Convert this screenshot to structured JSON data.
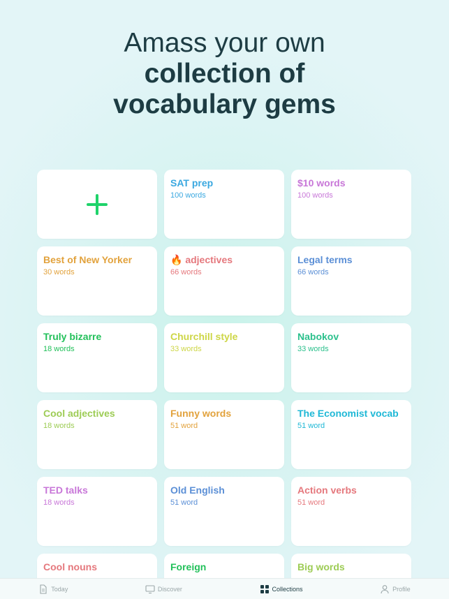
{
  "headline": {
    "line1": "Amass your own",
    "line2": "collection of",
    "line3": "vocabulary gems"
  },
  "collections": [
    {
      "title": "SAT prep",
      "count": "100 words",
      "color": "#3aa8e0"
    },
    {
      "title": "$10 words",
      "count": "100 words",
      "color": "#c877d8"
    },
    {
      "title": "Best of New Yorker",
      "count": "30 words",
      "color": "#e2a23c"
    },
    {
      "title": "🔥 adjectives",
      "count": "66 words",
      "color": "#e5787d"
    },
    {
      "title": "Legal terms",
      "count": "66 words",
      "color": "#5b8fd6"
    },
    {
      "title": "Truly bizarre",
      "count": "18 words",
      "color": "#22c05a"
    },
    {
      "title": "Churchill style",
      "count": "33 words",
      "color": "#cdd646"
    },
    {
      "title": "Nabokov",
      "count": "33 words",
      "color": "#2bc08c"
    },
    {
      "title": "Cool adjectives",
      "count": "18 words",
      "color": "#9dcc55"
    },
    {
      "title": "Funny words",
      "count": "51 word",
      "color": "#e2a23c"
    },
    {
      "title": "The Economist vocab",
      "count": "51 word",
      "color": "#1fb8d6"
    },
    {
      "title": "TED talks",
      "count": "18 words",
      "color": "#c877d8"
    },
    {
      "title": "Old English",
      "count": "51 word",
      "color": "#5b8fd6"
    },
    {
      "title": "Action verbs",
      "count": "51 word",
      "color": "#e5787d"
    },
    {
      "title": "Cool nouns",
      "count": "",
      "color": "#e5787d"
    },
    {
      "title": "Foreign",
      "count": "",
      "color": "#22c05a"
    },
    {
      "title": "Big words",
      "count": "",
      "color": "#9dcc55"
    }
  ],
  "tabs": [
    {
      "label": "Today",
      "icon": "document-icon",
      "active": false
    },
    {
      "label": "Discover",
      "icon": "monitor-icon",
      "active": false
    },
    {
      "label": "Collections",
      "icon": "grid-icon",
      "active": true
    },
    {
      "label": "Profile",
      "icon": "person-icon",
      "active": false
    }
  ],
  "colors": {
    "accent": "#1fd36a",
    "heading": "#1d3c43"
  }
}
